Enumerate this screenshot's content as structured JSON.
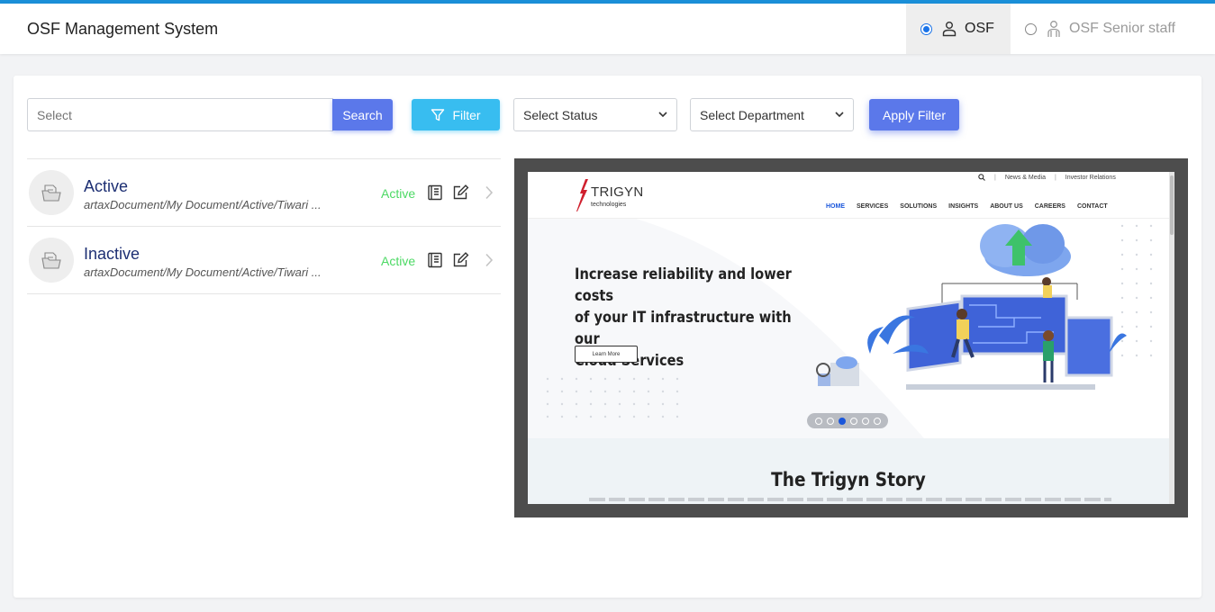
{
  "app": {
    "title": "OSF Management System",
    "accent_color": "#1a8fd8"
  },
  "roles": [
    {
      "label": "OSF",
      "selected": true,
      "icon": "user-icon"
    },
    {
      "label": "OSF Senior staff",
      "selected": false,
      "icon": "users-icon"
    }
  ],
  "toolbar": {
    "search_placeholder": "Select",
    "search_label": "Search",
    "filter_label": "Filter",
    "status_select": "Select Status",
    "department_select": "Select Department",
    "apply_label": "Apply Filter"
  },
  "documents": [
    {
      "title": "Active",
      "path": "artaxDocument/My Document/Active/Tiwari ...",
      "status": "Active"
    },
    {
      "title": "Inactive",
      "path": "artaxDocument/My Document/Active/Tiwari ...",
      "status": "Active"
    }
  ],
  "preview": {
    "logo_text": "TRIGYN",
    "logo_sub": "technologies",
    "util_links": [
      "News & Media",
      "Investor Relations"
    ],
    "nav": [
      "HOME",
      "SERVICES",
      "SOLUTIONS",
      "INSIGHTS",
      "ABOUT US",
      "CAREERS",
      "CONTACT"
    ],
    "hero_line1": "Increase reliability and lower costs",
    "hero_line2": "of your IT infrastructure with our",
    "hero_line3": "Cloud Services",
    "learn_more": "Learn More",
    "carousel_active": 3,
    "carousel_count": 6,
    "story_title": "The Trigyn Story"
  }
}
